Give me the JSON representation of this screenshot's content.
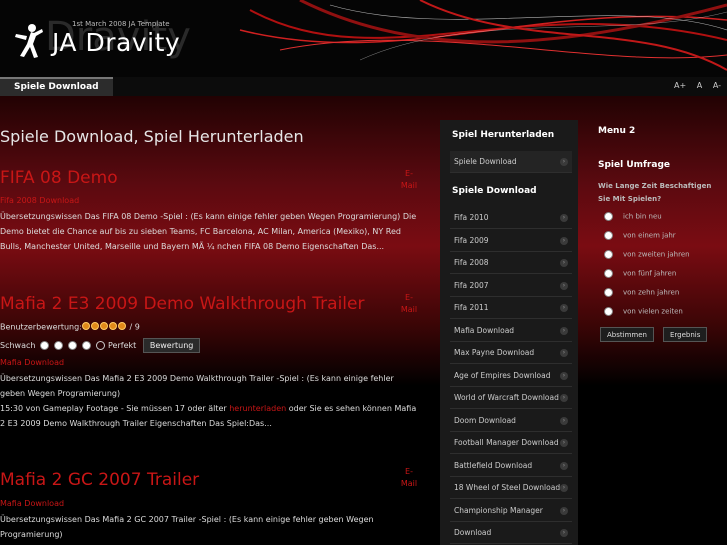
{
  "header": {
    "logo_text": "JA Dravity",
    "logo_ghost": "Dravity",
    "tagline": "1st March 2008 JA Template"
  },
  "nav": {
    "tab_label": "Spiele Download",
    "font_tools": [
      "A+",
      "A",
      "A-"
    ]
  },
  "main": {
    "page_title": "Spiele Download, Spiel Herunterladen",
    "email_label_1": "E-",
    "email_label_2": "Mail",
    "articles": [
      {
        "title": "FIFA 08 Demo",
        "sublink": "Fifa 2008 Download",
        "body": "Übersetzungswissen Das FIFA 08 Demo -Spiel : (Es kann einige fehler geben Wegen Programierung) Die Demo bietet die Chance auf bis zu sieben Teams, FC Barcelona, AC Milan, America (Mexiko), NY Red Bulls, Manchester United, Marseille und Bayern MÃ ¼ nchen FIFA 08 Demo Eigenschaften Das..."
      },
      {
        "title": "Mafia 2 E3 2009 Demo Walkthrough Trailer",
        "rating_label": "Benutzerbewertung:",
        "rating_value": "/ 9",
        "vote_low": "Schwach",
        "vote_high": "Perfekt",
        "vote_button": "Bewertung",
        "sublink": "Mafia Download",
        "body_part1": "Übersetzungswissen Das Mafia 2 E3 2009 Demo Walkthrough Trailer -Spiel : (Es kann einige fehler geben Wegen Programierung)",
        "body_part2": "15:30 von Gameplay Footage - Sie müssen 17 oder älter ",
        "body_link": "herunterladen",
        "body_part3": " oder Sie es sehen können Mafia 2 E3 2009 Demo Walkthrough Trailer Eigenschaften Das Spiel:Das..."
      },
      {
        "title": "Mafia 2 GC 2007 Trailer",
        "sublink": "Mafia Download",
        "body": "Übersetzungswissen Das Mafia 2 GC 2007 Trailer -Spiel : (Es kann einige fehler geben Wegen Programierung)"
      }
    ]
  },
  "sidebar1": {
    "heading1": "Spiel Herunterladen",
    "first_item": "Spiele Download",
    "heading2": "Spiele Download",
    "items": [
      "Fifa 2010",
      "Fifa 2009",
      "Fifa 2008",
      "Fifa 2007",
      "Fifa 2011",
      "Mafia Download",
      "Max Payne Download",
      "Age of Empires Download",
      "World of Warcraft Download",
      "Doom Download",
      "Football Manager Download",
      "Battlefield Download",
      "18 Wheel of Steel Download",
      "Championship Manager",
      "Download"
    ]
  },
  "sidebar2": {
    "menu_heading": "Menu 2",
    "poll_heading": "Spiel Umfrage",
    "poll_question": "Wie Lange Zeit Beschaftigen Sie Mit Spielen?",
    "options": [
      "ich bin neu",
      "von einem jahr",
      "von zweiten jahren",
      "von fünf jahren",
      "von zehn jahren",
      "von vielen zeiten"
    ],
    "vote_button": "Abstimmen",
    "results_button": "Ergebnis"
  },
  "colors": {
    "accent_red": "#c81616",
    "background": "#000000"
  }
}
